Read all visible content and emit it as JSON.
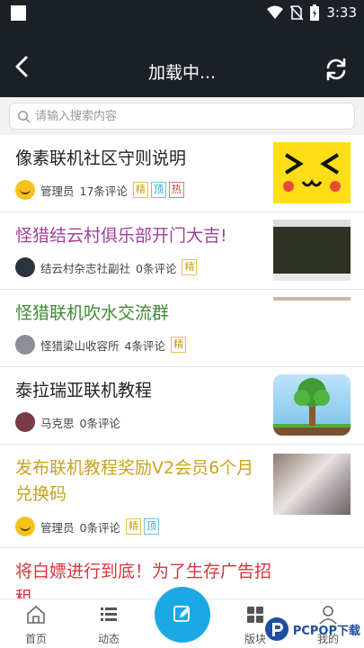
{
  "status_bar": {
    "time": "3:33"
  },
  "appbar": {
    "title": "加载中..."
  },
  "search": {
    "placeholder": "请输入搜索内容"
  },
  "posts": [
    {
      "title": "像素联机社区守则说明",
      "title_color": "#222222",
      "author": "管理员",
      "comments": "17条评论",
      "tags": [
        "精",
        "顶",
        "热"
      ],
      "thumb": "pikachu-face"
    },
    {
      "title": "怪猎结云村俱乐部开门大吉!",
      "title_color": "#a0409a",
      "author": "结云村杂志社副社",
      "comments": "0条评论",
      "tags": [
        "精"
      ],
      "thumb": "game-screenshot"
    },
    {
      "title": "怪猎联机吹水交流群",
      "title_color": "#3d8a33",
      "author": "怪猎梁山收容所",
      "comments": "4条评论",
      "tags": [
        "精"
      ],
      "thumb": "blank-image"
    },
    {
      "title": "泰拉瑞亚联机教程",
      "title_color": "#222222",
      "author": "马克思",
      "comments": "0条评论",
      "tags": [],
      "thumb": "terraria-tree"
    },
    {
      "title": "发布联机教程奖励V2会员6个月兑换码",
      "title_color": "#c9a21e",
      "author": "管理员",
      "comments": "0条评论",
      "tags": [
        "精",
        "顶"
      ],
      "thumb": "sleeping-photo"
    },
    {
      "title": "将白嫖进行到底！为了生存广告招租",
      "title_color": "#d9343f"
    }
  ],
  "tabbar": {
    "home": "首页",
    "moments": "动态",
    "section": "版块",
    "mine": "我的"
  },
  "watermark": {
    "text": "PCPOP下载"
  },
  "colors": {
    "header_bg": "#1c2027",
    "accent": "#1ba8e5",
    "tag_jing": "#c79c16",
    "tag_ding": "#2a9ed6",
    "tag_re": "#d9343f"
  }
}
